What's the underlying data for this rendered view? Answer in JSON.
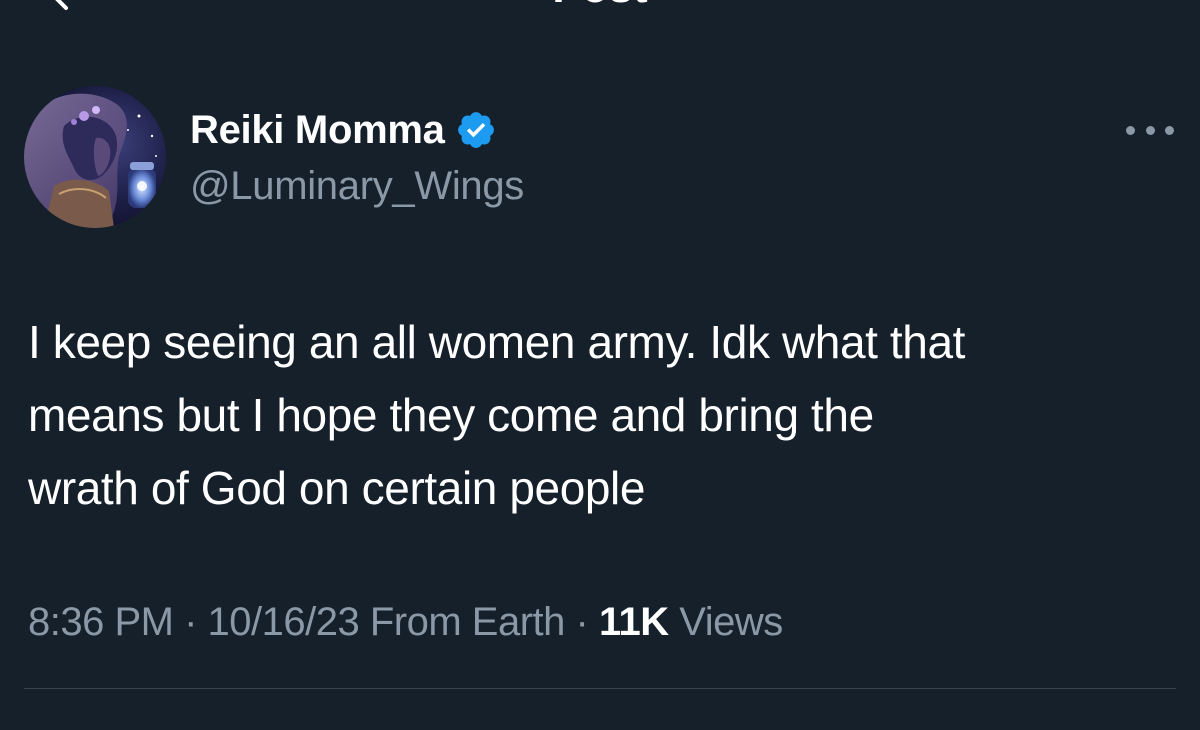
{
  "header": {
    "title": "Post"
  },
  "tweet": {
    "display_name": "Reiki Momma",
    "handle": "@Luminary_Wings",
    "text_lines": [
      "I keep seeing an all women army. Idk what that",
      "means but I  hope they come and bring the",
      "wrath of God on certain people"
    ],
    "time": "8:36 PM",
    "date": "10/16/23",
    "source": "From Earth",
    "separator": "·",
    "views_count": "11K",
    "views_label": "Views"
  },
  "icons": {
    "back": "back-arrow-icon",
    "verified": "verified-badge-icon",
    "more": "more-options-icon"
  },
  "colors": {
    "background": "#15202b",
    "text_primary": "#ffffff",
    "text_secondary": "#8b98a5",
    "verified_blue": "#1d9bf0",
    "divider": "#38444d"
  }
}
